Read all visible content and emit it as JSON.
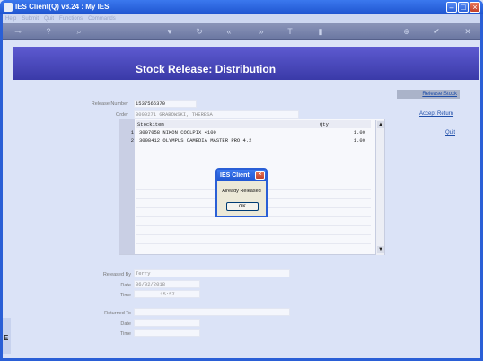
{
  "window": {
    "title": "IES Client(Q) v8.24 : My IES"
  },
  "menu": [
    "Help",
    "Submit",
    "Quit",
    "Functions",
    "Commands"
  ],
  "toolbar_icons": [
    "key-icon",
    "help-icon",
    "search-icon",
    "heart-icon",
    "refresh-icon",
    "back-icon",
    "forward-icon",
    "text-icon",
    "page-icon",
    "add-icon",
    "check-icon",
    "close-icon"
  ],
  "page": {
    "title": "Stock Release: Distribution"
  },
  "form": {
    "release_number_label": "Release Number",
    "release_number": "1537566370",
    "order_label": "Order",
    "order": "0000271 GRABOWSKI, THERESA",
    "released_by_label": "Released By",
    "released_by": "Terry",
    "date_label": "Date",
    "date": "06/02/2018",
    "time_label": "Time",
    "time": "15:57",
    "returned_to_label": "Returned To",
    "returned_to": "",
    "returned_date_label": "Date",
    "returned_date": "",
    "returned_time_label": "Time",
    "returned_time": ""
  },
  "grid": {
    "headers": [
      "Stockitem",
      "Qty"
    ],
    "rows": [
      {
        "idx": "1",
        "item": "3007058 NIKON COOLPIX 4100",
        "qty": "1.00"
      },
      {
        "idx": "2",
        "item": "3008412 OLYMPUS CAMEDIA MASTER PRO 4.2",
        "qty": "1.00"
      }
    ]
  },
  "actions": {
    "release": "Release Stock",
    "accept": "Accept Return",
    "quit": "Quit"
  },
  "dialog": {
    "title": "IES Client",
    "message": "Already Released",
    "ok": "OK"
  },
  "left_strip": {
    "label": "E"
  }
}
